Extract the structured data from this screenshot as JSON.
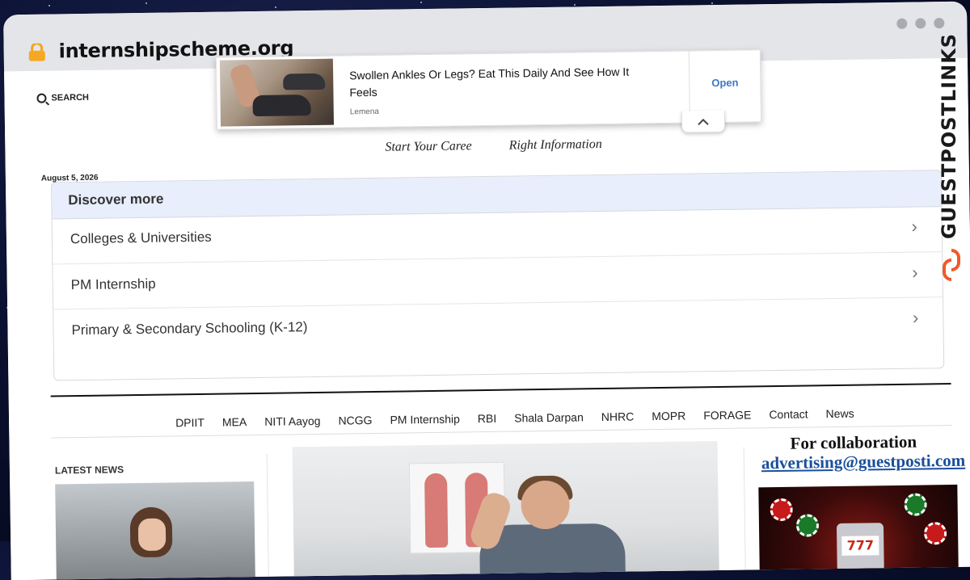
{
  "browser": {
    "url": "internshipscheme.org",
    "lock_icon": "lock-icon",
    "window_controls": [
      "dot",
      "dot",
      "dot"
    ]
  },
  "header": {
    "search_label": "SEARCH",
    "tagline_left": "Start Your Caree",
    "tagline_right": "Right Information",
    "date": "August 5, 2026"
  },
  "ad": {
    "title": "Swollen Ankles Or Legs? Eat This Daily And See How It Feels",
    "brand": "Lemena",
    "cta": "Open",
    "collapse_icon": "chevron-up-icon"
  },
  "discover": {
    "title": "Discover more",
    "items": [
      {
        "label": "Colleges & Universities"
      },
      {
        "label": "PM Internship"
      },
      {
        "label": "Primary & Secondary Schooling (K-12)"
      }
    ]
  },
  "nav": {
    "items": [
      "DPIIT",
      "MEA",
      "NITI Aayog",
      "NCGG",
      "PM Internship",
      "RBI",
      "Shala Darpan",
      "NHRC",
      "MOPR",
      "FORAGE",
      "Contact",
      "News"
    ]
  },
  "sidebar_left": {
    "heading": "LATEST NEWS"
  },
  "sidebar_right": {
    "collab_title": "For collaboration",
    "collab_email": "advertising@guestposti.com",
    "slot_text": "777"
  },
  "brand_watermark": {
    "text": "GUESTPOSTLINKS",
    "icon": "chain-link-icon",
    "accent": "#f05a28"
  }
}
